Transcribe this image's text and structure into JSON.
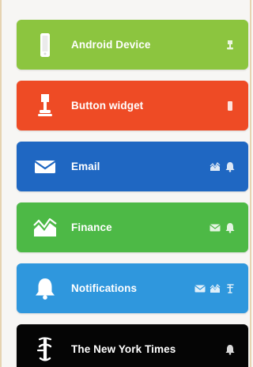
{
  "services": [
    {
      "name": "Android Device",
      "color": "#8cc53f",
      "icon": "android-device-icon",
      "related_icons": [
        "button-widget-icon"
      ]
    },
    {
      "name": "Button widget",
      "color": "#ee4b25",
      "icon": "button-widget-icon",
      "related_icons": [
        "android-device-icon"
      ]
    },
    {
      "name": "Email",
      "color": "#1f67c2",
      "icon": "email-icon",
      "related_icons": [
        "finance-icon",
        "notifications-icon"
      ]
    },
    {
      "name": "Finance",
      "color": "#4db946",
      "icon": "finance-icon",
      "related_icons": [
        "email-icon",
        "notifications-icon"
      ]
    },
    {
      "name": "Notifications",
      "color": "#2f97dd",
      "icon": "notifications-icon",
      "related_icons": [
        "email-icon",
        "finance-icon",
        "nytimes-icon"
      ]
    },
    {
      "name": "The New York Times",
      "color": "#050505",
      "icon": "nytimes-icon",
      "related_icons": [
        "notifications-icon"
      ]
    }
  ]
}
